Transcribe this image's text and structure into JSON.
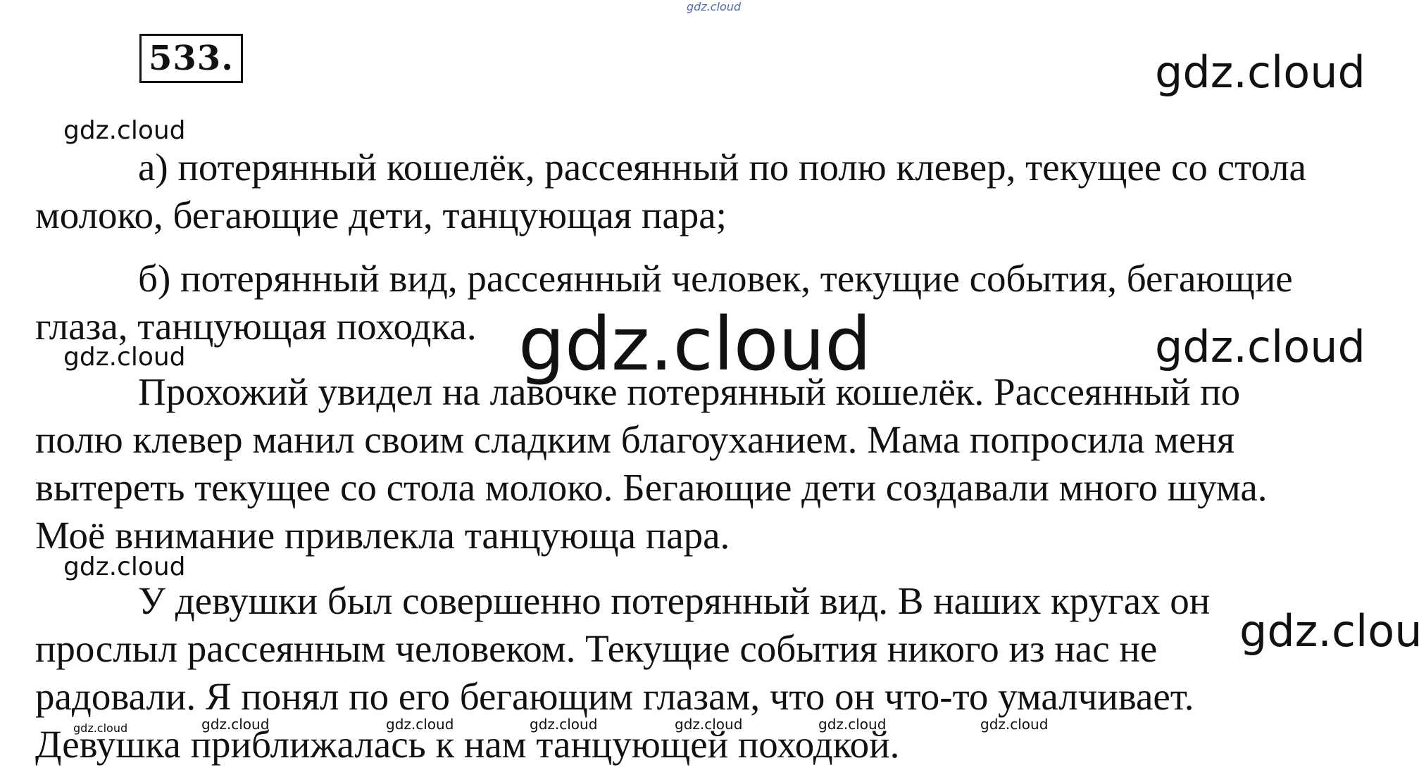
{
  "task": {
    "number": "533."
  },
  "watermark": {
    "text": "gdz.cloud"
  },
  "lines": [
    "а) потерянный кошелёк, рассеянный по полю клевер, текущее со стола",
    "молоко, бегающие дети, танцующая пара;",
    "б) потерянный вид, рассеянный человек, текущие события, бегающие",
    "глаза, танцующая походка.",
    "Прохожий увидел на лавочке потерянный кошелёк. Рассеянный по",
    "полю клевер манил своим сладким благоуханием. Мама попросила меня",
    "вытереть текущее со стола молоко. Бегающие дети создавали много шума.",
    "Моё внимание привлекла танцующа пара.",
    "У девушки был совершенно потерянный вид. В наших кругах он",
    "прослыл рассеянным человеком. Текущие события никого из нас не",
    "радовали. Я понял по его бегающим глазам, что он что-то умалчивает.",
    "Девушка приближалась к нам танцующей походкой."
  ]
}
